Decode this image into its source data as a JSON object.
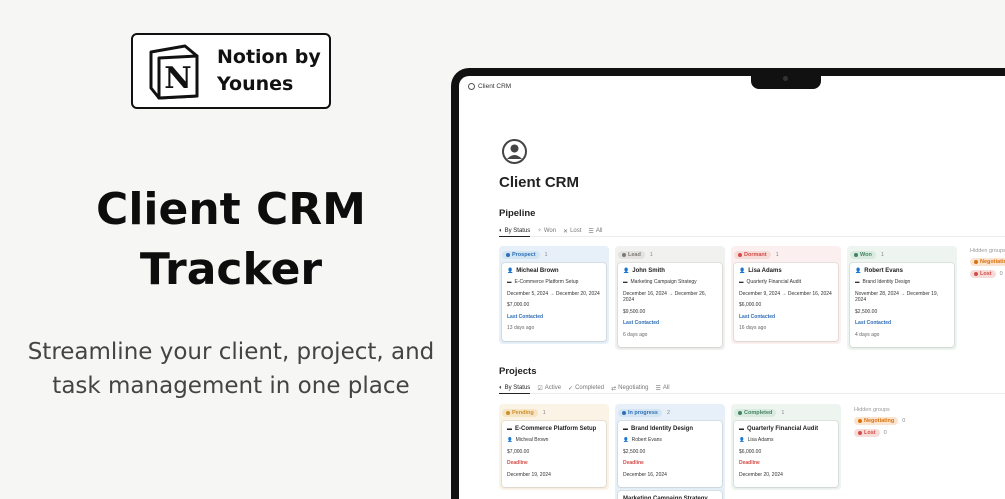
{
  "brand": {
    "logo_letter": "N",
    "logo_text_line1": "Notion by",
    "logo_text_line2": "Younes"
  },
  "hero": {
    "title_line1": "Client CRM",
    "title_line2": "Tracker",
    "subtitle_line1": "Streamline your client, project, and",
    "subtitle_line2": "task management in one place"
  },
  "window": {
    "title": "Client CRM"
  },
  "page": {
    "title": "Client CRM"
  },
  "pipeline": {
    "title": "Pipeline",
    "tabs": [
      {
        "label": "By Status",
        "icon": "status-icon"
      },
      {
        "label": "Won",
        "icon": "trophy-icon"
      },
      {
        "label": "Lost",
        "icon": "x-icon"
      },
      {
        "label": "All",
        "icon": "list-icon"
      }
    ],
    "columns": [
      {
        "label": "Prospect",
        "count": "1",
        "color": "#2f6fb5",
        "bg": "#e7f0f8",
        "pill_bg": "#d3e5f3",
        "card": {
          "name": "Micheal Brown",
          "project": "E-Commerce Platform Setup",
          "dates": "December 5, 2024 → December 20, 2024",
          "value": "$7,000.00",
          "label": "Last Contacted",
          "ago": "13 days ago"
        }
      },
      {
        "label": "Lead",
        "count": "1",
        "color": "#7d7a75",
        "bg": "#f1f1ef",
        "pill_bg": "#e3e2e0",
        "card": {
          "name": "John Smith",
          "project": "Marketing Campaign Strategy",
          "dates": "December 16, 2024 → December 26, 2024",
          "value": "$9,500.00",
          "label": "Last Contacted",
          "ago": "6 days ago"
        }
      },
      {
        "label": "Dormant",
        "count": "1",
        "color": "#d44c47",
        "bg": "#fbf0ef",
        "pill_bg": "#f5dcd9",
        "card": {
          "name": "Lisa Adams",
          "project": "Quarterly Financial Audit",
          "dates": "December 9, 2024 → December 16, 2024",
          "value": "$6,000.00",
          "label": "Last Contacted",
          "ago": "16 days ago"
        }
      },
      {
        "label": "Won",
        "count": "1",
        "color": "#448361",
        "bg": "#eef5f0",
        "pill_bg": "#d9ebe0",
        "card": {
          "name": "Robert Evans",
          "project": "Brand Identity Design",
          "dates": "November 28, 2024 → December 19, 2024",
          "value": "$2,500.00",
          "label": "Last Contacted",
          "ago": "4 days ago"
        }
      }
    ],
    "hidden": {
      "label": "Hidden groups",
      "items": [
        {
          "label": "Negotiating",
          "count": "",
          "color": "#d9730d",
          "pill_bg": "#fae3cf"
        },
        {
          "label": "Lost",
          "count": "0",
          "color": "#d44c47",
          "pill_bg": "#f5dcd9"
        }
      ]
    }
  },
  "projects": {
    "title": "Projects",
    "tabs": [
      {
        "label": "By Status",
        "icon": "status-icon"
      },
      {
        "label": "Active",
        "icon": "checkbox-icon"
      },
      {
        "label": "Completed",
        "icon": "check-icon"
      },
      {
        "label": "Negotiating",
        "icon": "arrows-icon"
      },
      {
        "label": "All",
        "icon": "list-icon"
      }
    ],
    "columns": [
      {
        "label": "Pending",
        "count": "1",
        "color": "#cb912f",
        "bg": "#fbf3e6",
        "pill_bg": "#f7e4c3",
        "card": {
          "name": "E-Commerce Platform Setup",
          "client": "Micheal Brown",
          "value": "$7,000.00",
          "label": "Deadline",
          "date": "December 19, 2024"
        }
      },
      {
        "label": "In progress",
        "count": "2",
        "color": "#2f6fb5",
        "bg": "#e7f0f8",
        "pill_bg": "#d3e5f3",
        "card": {
          "name": "Brand Identity Design",
          "client": "Robert Evans",
          "value": "$2,500.00",
          "label": "Deadline",
          "date": "December 16, 2024"
        },
        "next": "Marketing Campaign Strategy"
      },
      {
        "label": "Completed",
        "count": "1",
        "color": "#448361",
        "bg": "#eef5f0",
        "pill_bg": "#d9ebe0",
        "card": {
          "name": "Quarterly Financial Audit",
          "client": "Lisa Adams",
          "value": "$6,000.00",
          "label": "Deadline",
          "date": "December 20, 2024"
        }
      }
    ],
    "hidden": {
      "label": "Hidden groups",
      "items": [
        {
          "label": "Negotiating",
          "count": "0",
          "color": "#d9730d",
          "pill_bg": "#fae3cf"
        },
        {
          "label": "Lost",
          "count": "0",
          "color": "#d44c47",
          "pill_bg": "#f5dcd9"
        }
      ]
    }
  }
}
